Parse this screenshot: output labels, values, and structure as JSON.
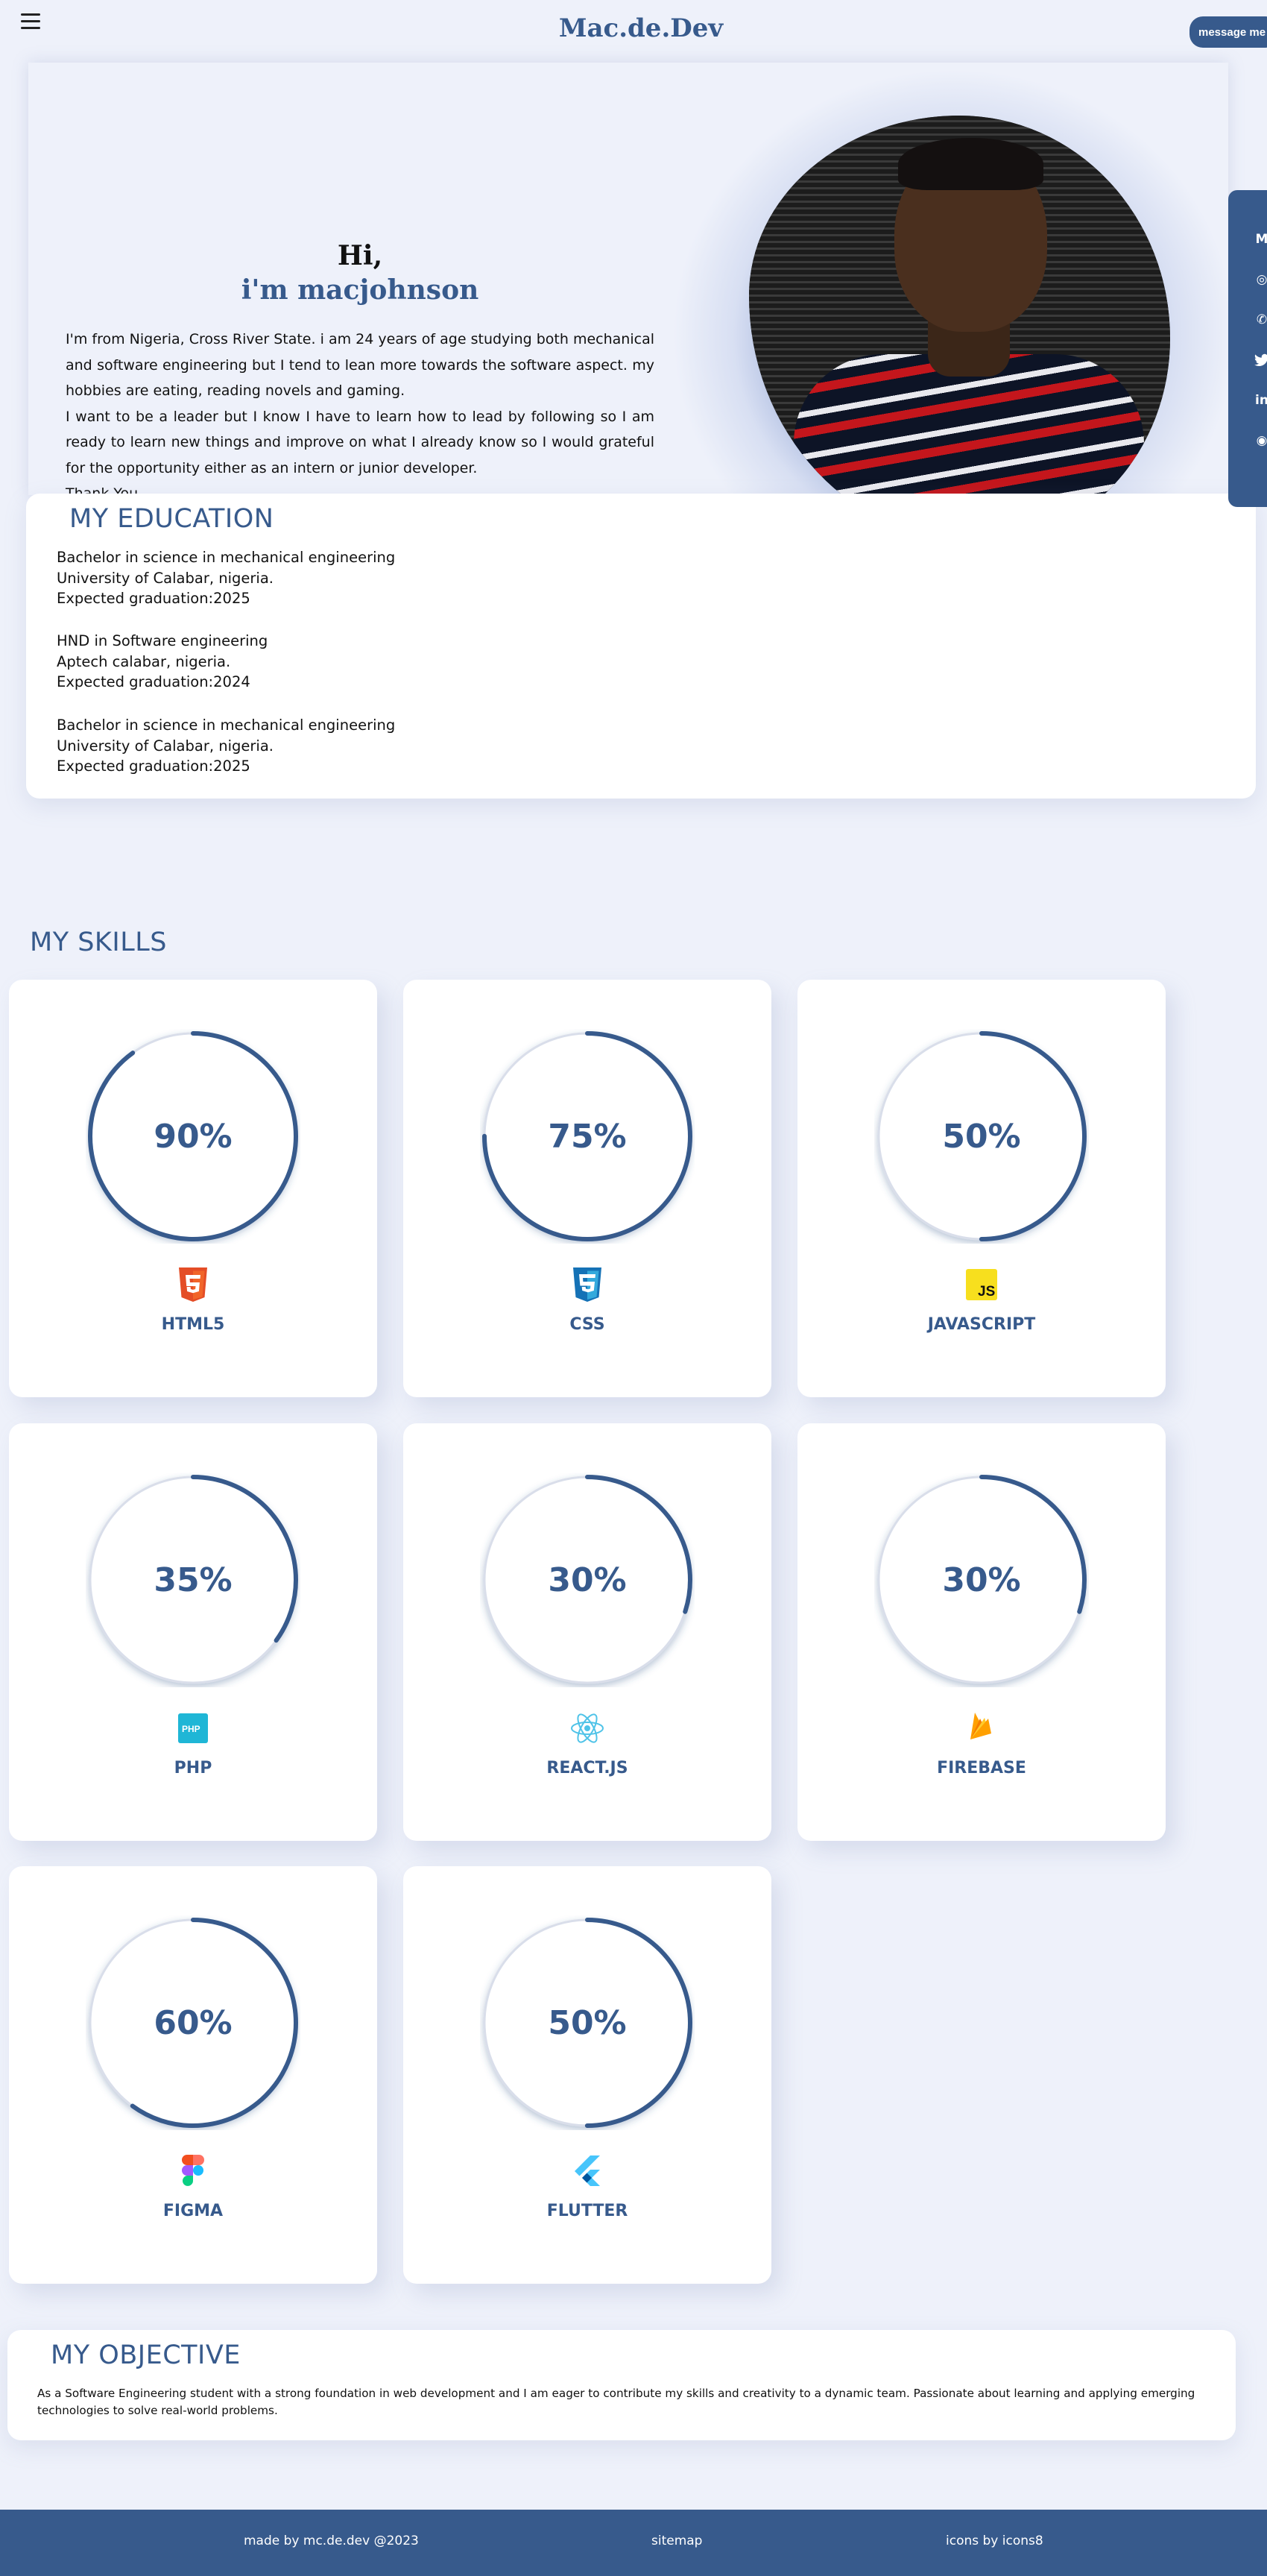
{
  "header": {
    "brand": "Mac.de.Dev",
    "message_button": "message me",
    "icons": {
      "menu": "hamburger-menu-icon"
    }
  },
  "hero": {
    "hi": "Hi,",
    "name": "i'm macjohnson",
    "bio_paragraphs": [
      "I'm from Nigeria, Cross River State. i am 24 years of age studying both mechanical and software engineering but I tend to lean more towards the software aspect. my hobbies are eating, reading novels and gaming.",
      "I want to be a leader but I know I have to learn how to lead by following so I am ready to learn new things and improve on what I already know so I would grateful for the opportunity either as an intern or junior developer.",
      "Thank You."
    ],
    "photo_alt": "profile photo"
  },
  "social": {
    "items": [
      {
        "icon": "gmail-icon",
        "glyph": "M"
      },
      {
        "icon": "instagram-icon",
        "glyph": "◎"
      },
      {
        "icon": "whatsapp-icon",
        "glyph": "✆"
      },
      {
        "icon": "twitter-icon",
        "glyph": "🐦"
      },
      {
        "icon": "linkedin-icon",
        "glyph": "in"
      },
      {
        "icon": "github-icon",
        "glyph": "◉"
      }
    ]
  },
  "education": {
    "title": "MY EDUCATION",
    "entries": [
      {
        "degree": "Bachelor in science in mechanical engineering",
        "school": "University of Calabar, nigeria.",
        "graduation": "Expected graduation:2025"
      },
      {
        "degree": "HND in Software engineering",
        "school": "Aptech calabar, nigeria.",
        "graduation": "Expected graduation:2024"
      },
      {
        "degree": "Bachelor in science in mechanical engineering",
        "school": "University of Calabar, nigeria.",
        "graduation": "Expected graduation:2025"
      }
    ]
  },
  "skills": {
    "title": "MY SKILLS",
    "items": [
      {
        "name": "HTML5",
        "percent": 90,
        "label": "90%",
        "icon": "html5-icon"
      },
      {
        "name": "CSS",
        "percent": 75,
        "label": "75%",
        "icon": "css3-icon"
      },
      {
        "name": "JAVASCRIPT",
        "percent": 50,
        "label": "50%",
        "icon": "javascript-icon"
      },
      {
        "name": "PHP",
        "percent": 35,
        "label": "35%",
        "icon": "php-icon"
      },
      {
        "name": "REACT.JS",
        "percent": 30,
        "label": "30%",
        "icon": "react-icon"
      },
      {
        "name": "FIREBASE",
        "percent": 30,
        "label": "30%",
        "icon": "firebase-icon"
      },
      {
        "name": "FIGMA",
        "percent": 60,
        "label": "60%",
        "icon": "figma-icon"
      },
      {
        "name": "FLUTTER",
        "percent": 50,
        "label": "50%",
        "icon": "flutter-icon"
      }
    ]
  },
  "objective": {
    "title": "MY OBJECTIVE",
    "text": "As a Software Engineering student with a strong foundation in web development and I am eager to contribute my skills and creativity to a dynamic team. Passionate about learning and applying emerging technologies to solve real-world problems."
  },
  "footer": {
    "made_by": "made by mc.de.dev @2023",
    "sitemap": "sitemap",
    "icons_credit": "icons by icons8"
  },
  "colors": {
    "accent": "#375a8c",
    "background": "#eef1fa",
    "card": "#ffffff"
  }
}
